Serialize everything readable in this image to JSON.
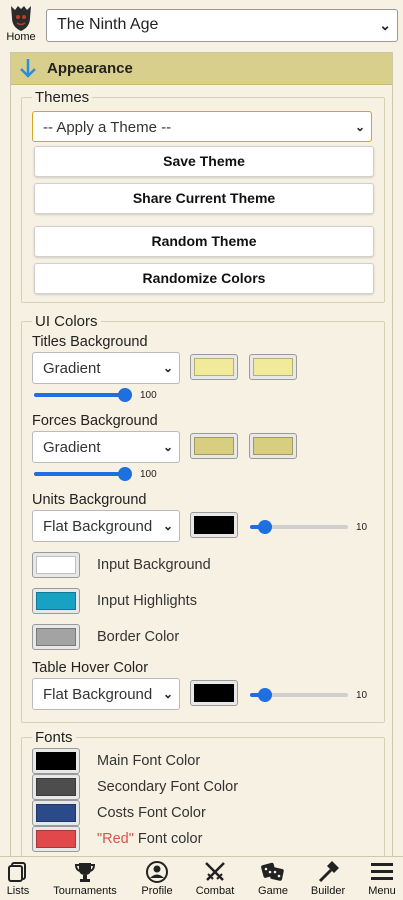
{
  "topbar": {
    "home_label": "Home",
    "army_select_value": "The Ninth Age"
  },
  "panel": {
    "title": "Appearance",
    "themes": {
      "legend": "Themes",
      "apply_select": "-- Apply a Theme --",
      "save": "Save Theme",
      "share": "Share Current Theme",
      "random": "Random Theme",
      "randomize": "Randomize Colors"
    },
    "ui_colors": {
      "legend": "UI Colors",
      "titles_bg": {
        "label": "Titles Background",
        "mode": "Gradient",
        "color1": "#f1ea9a",
        "color2": "#f1ea9a",
        "range_value": "100",
        "range_fraction": 1.0
      },
      "forces_bg": {
        "label": "Forces Background",
        "mode": "Gradient",
        "color1": "#d8ce82",
        "color2": "#d8ce82",
        "range_value": "100",
        "range_fraction": 1.0
      },
      "units_bg": {
        "label": "Units Background",
        "mode": "Flat Background",
        "color": "#000000",
        "range_value": "10",
        "range_fraction": 0.1
      },
      "input_bg": {
        "label": "Input Background",
        "color": "#ffffff"
      },
      "input_highlights": {
        "label": "Input Highlights",
        "color": "#17a2c4"
      },
      "border_color": {
        "label": "Border Color",
        "color": "#a3a3a3"
      },
      "table_hover": {
        "label": "Table Hover Color",
        "mode": "Flat Background",
        "color": "#000000",
        "range_value": "10",
        "range_fraction": 0.1
      }
    },
    "fonts": {
      "legend": "Fonts",
      "main": {
        "label": "Main Font Color",
        "color": "#000000"
      },
      "secondary": {
        "label": "Secondary Font Color",
        "color": "#4d4d4d"
      },
      "costs": {
        "label": "Costs Font Color",
        "color": "#2a4a8a"
      },
      "red": {
        "label_red": "\"Red\"",
        "label_rest": " Font color",
        "color": "#e0484a"
      }
    }
  },
  "bottom_nav": {
    "lists": "Lists",
    "tournaments": "Tournaments",
    "profile": "Profile",
    "combat": "Combat",
    "game": "Game",
    "builder": "Builder",
    "menu": "Menu"
  },
  "colors": {
    "background": "#f6f1e2",
    "header": "#d8cf8c",
    "accent_blue": "#1e6fe0",
    "arrow_blue": "#2a8fd8"
  }
}
